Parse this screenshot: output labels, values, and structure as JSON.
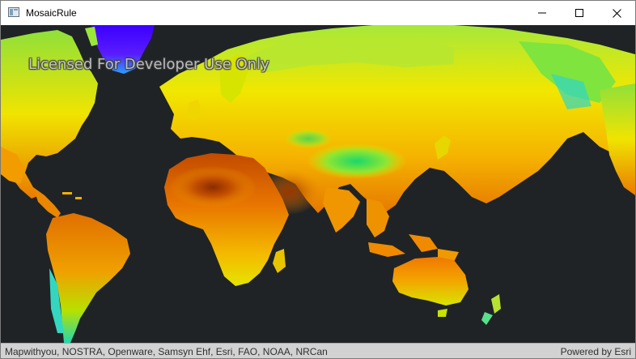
{
  "window": {
    "title": "MosaicRule",
    "icon": "app-window-icon",
    "controls": {
      "minimize_icon": "minimize-icon",
      "maximize_icon": "maximize-icon",
      "close_icon": "close-icon"
    }
  },
  "map": {
    "watermark": "Licensed For Developer Use Only",
    "background_color": "#1f2326",
    "attribution": "Mapwithyou, NOSTRA, Openware, Samsyn Ehf, Esri, FAO, NOAA, NRCan",
    "powered_by": "Powered by Esri"
  }
}
